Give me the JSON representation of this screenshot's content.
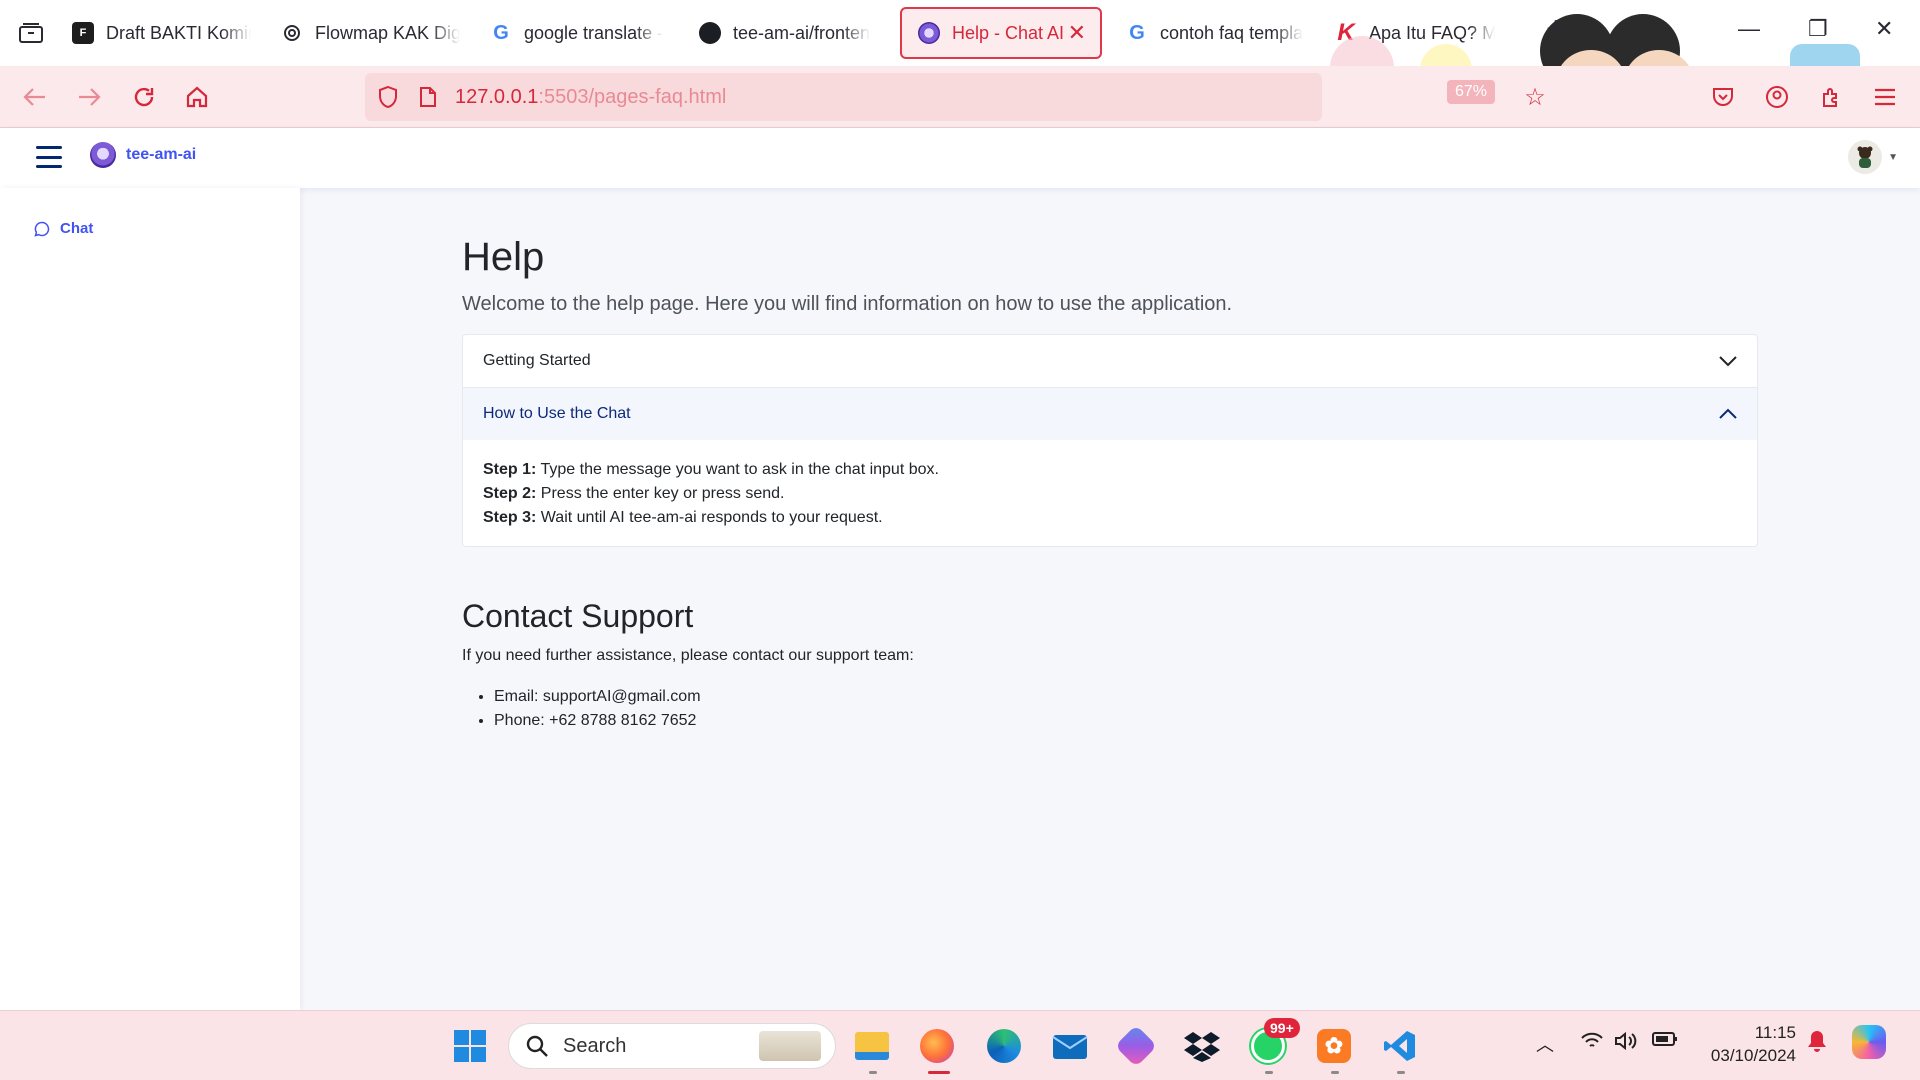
{
  "browser": {
    "tabs": [
      {
        "title": "Draft BAKTI Komin",
        "icon": "figma-icon"
      },
      {
        "title": "Flowmap KAK Digi",
        "icon": "chatgpt-icon"
      },
      {
        "title": "google translate -",
        "icon": "google-icon"
      },
      {
        "title": "tee-am-ai/fronten",
        "icon": "github-icon"
      },
      {
        "title": "Help - Chat AI",
        "icon": "chat-ai-icon",
        "active": true
      },
      {
        "title": "contoh faq templa",
        "icon": "google-icon"
      },
      {
        "title": "Apa Itu FAQ? Man",
        "icon": "k-icon"
      }
    ],
    "url_host": "127.0.0.1",
    "url_path": ":5503/pages-faq.html",
    "zoom": "67%"
  },
  "app": {
    "brand": "tee-am-ai",
    "sidebar_items": [
      {
        "label": "Chat",
        "icon": "chat-bubble-icon"
      }
    ]
  },
  "main": {
    "title": "Help",
    "intro": "Welcome to the help page. Here you will find information on how to use the application.",
    "accordion": [
      {
        "title": "Getting Started",
        "open": false
      },
      {
        "title": "How to Use the Chat",
        "open": true,
        "steps": [
          {
            "label": "Step 1:",
            "text": "Type the message you want to ask in the chat input box."
          },
          {
            "label": "Step 2:",
            "text": "Press the enter key or press send."
          },
          {
            "label": "Step 3:",
            "text": "Wait until AI tee-am-ai responds to your request."
          }
        ]
      }
    ],
    "contact": {
      "title": "Contact Support",
      "text": "If you need further assistance, please contact our support team:",
      "email": "Email: supportAI@gmail.com",
      "phone": "Phone: +62 8788 8162 7652"
    }
  },
  "taskbar": {
    "search_label": "Search",
    "whatsapp_badge": "99+",
    "time": "11:15",
    "date": "03/10/2024"
  },
  "colors": {
    "accent": "#4154f1",
    "browser_accent": "#d6283b",
    "navy": "#012970"
  }
}
